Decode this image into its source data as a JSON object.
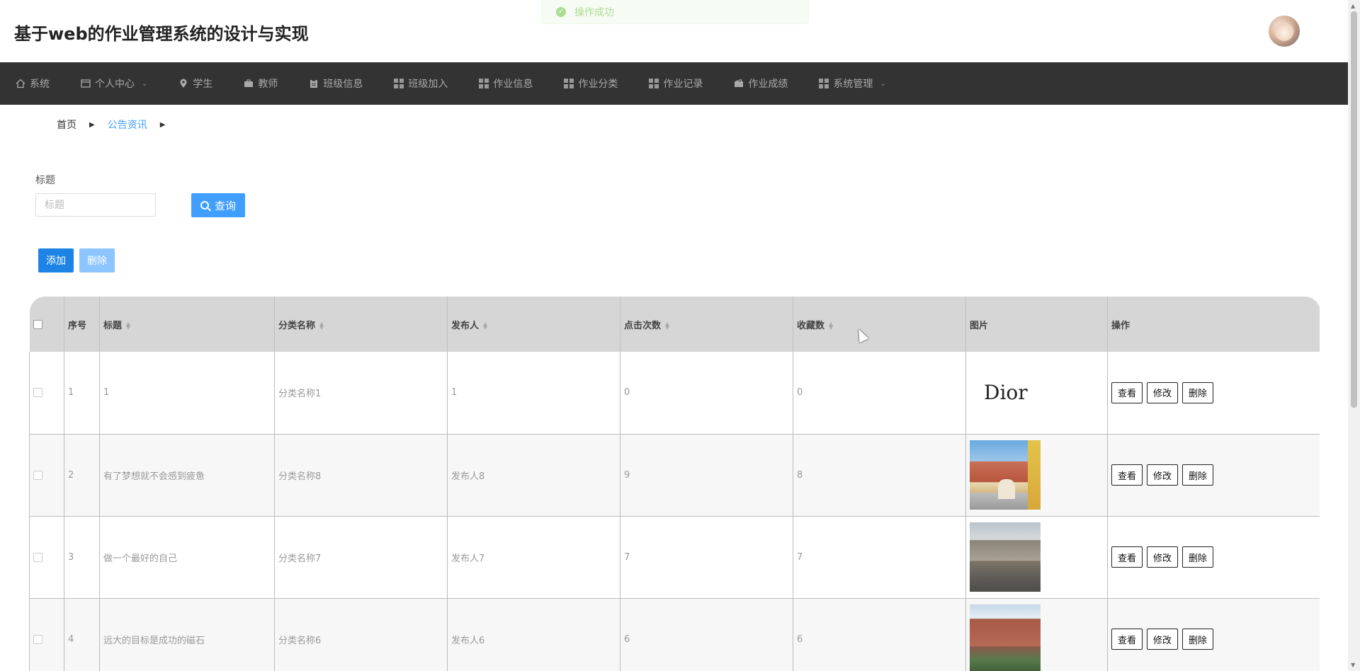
{
  "header": {
    "title": "基于web的作业管理系统的设计与实现"
  },
  "toast": {
    "message": "操作成功"
  },
  "nav": {
    "items": [
      {
        "label": "系统",
        "icon": "home-icon",
        "has_dropdown": false
      },
      {
        "label": "个人中心",
        "icon": "window-icon",
        "has_dropdown": true
      },
      {
        "label": "学生",
        "icon": "location-icon",
        "has_dropdown": false
      },
      {
        "label": "教师",
        "icon": "briefcase-icon",
        "has_dropdown": false
      },
      {
        "label": "班级信息",
        "icon": "clipboard-icon",
        "has_dropdown": false
      },
      {
        "label": "班级加入",
        "icon": "grid-icon",
        "has_dropdown": false
      },
      {
        "label": "作业信息",
        "icon": "grid-icon",
        "has_dropdown": false
      },
      {
        "label": "作业分类",
        "icon": "grid-icon",
        "has_dropdown": false
      },
      {
        "label": "作业记录",
        "icon": "grid-icon",
        "has_dropdown": false
      },
      {
        "label": "作业成绩",
        "icon": "wallet-icon",
        "has_dropdown": false
      },
      {
        "label": "系统管理",
        "icon": "grid-icon",
        "has_dropdown": true
      }
    ]
  },
  "breadcrumb": {
    "home": "首页",
    "current": "公告资讯"
  },
  "search": {
    "label": "标题",
    "placeholder": "标题",
    "value": "",
    "button": "查询"
  },
  "actions": {
    "add": "添加",
    "delete": "删除"
  },
  "table": {
    "columns": [
      "序号",
      "标题",
      "分类名称",
      "发布人",
      "点击次数",
      "收藏数",
      "图片",
      "操作"
    ],
    "sortable": [
      false,
      true,
      true,
      true,
      true,
      true,
      false,
      false
    ],
    "rows": [
      {
        "index": "1",
        "title": "1",
        "category": "分类名称1",
        "publisher": "1",
        "clicks": "0",
        "favorites": "0",
        "image": "Dior"
      },
      {
        "index": "2",
        "title": "有了梦想就不会感到疲惫",
        "category": "分类名称8",
        "publisher": "发布人8",
        "clicks": "9",
        "favorites": "8",
        "image": "photo"
      },
      {
        "index": "3",
        "title": "做一个最好的自己",
        "category": "分类名称7",
        "publisher": "发布人7",
        "clicks": "7",
        "favorites": "7",
        "image": "photo"
      },
      {
        "index": "4",
        "title": "远大的目标是成功的磁石",
        "category": "分类名称6",
        "publisher": "发布人6",
        "clicks": "6",
        "favorites": "6",
        "image": "photo"
      }
    ],
    "row_actions": {
      "view": "查看",
      "edit": "修改",
      "delete": "删除"
    }
  }
}
